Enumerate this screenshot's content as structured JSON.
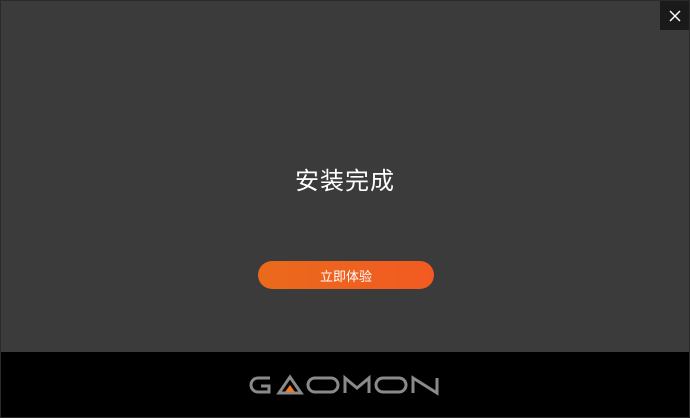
{
  "window": {
    "close_icon": "close-icon"
  },
  "main": {
    "title": "安装完成",
    "primary_button_label": "立即体验"
  },
  "footer": {
    "logo_text": "GAOMON"
  },
  "colors": {
    "background": "#3b3b3b",
    "footer": "#000000",
    "accent": "#ef6221",
    "logo_gray": "#8a8a8a",
    "logo_accent": "#f07a28"
  }
}
